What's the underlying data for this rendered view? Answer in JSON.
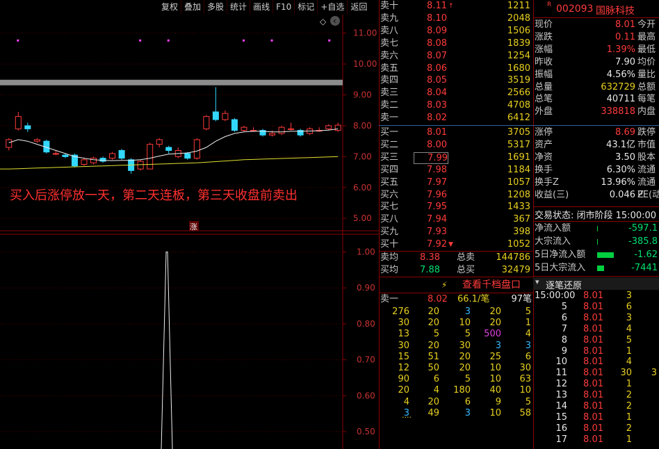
{
  "toolbar": [
    "复权",
    "叠加",
    "多股",
    "统计",
    "画线",
    "F10",
    "标记",
    "+自选",
    "返回"
  ],
  "chart": {
    "price_ticks": [
      "11.00",
      "10.00",
      "9.00",
      "8.00",
      "7.00",
      "6.00",
      "5.00"
    ],
    "indicator_ticks": [
      "1.00",
      "0.90",
      "0.80",
      "0.70",
      "0.60",
      "0.50"
    ],
    "annotation": "买入后涨停放一天，第二天连板，第三天收盘前卖出",
    "limit_badge": "涨",
    "diamond": "◇",
    "scroll_icon": "‹"
  },
  "chart_data": {
    "type": "candlestick",
    "ylim": [
      4.6,
      11.6
    ],
    "candles": [
      {
        "o": 7.3,
        "c": 7.55,
        "h": 7.6,
        "l": 7.2
      },
      {
        "o": 7.9,
        "c": 8.3,
        "h": 8.45,
        "l": 7.85
      },
      {
        "o": 8.0,
        "c": 7.9,
        "h": 8.1,
        "l": 7.8
      },
      {
        "o": 7.5,
        "c": 7.55,
        "h": 7.6,
        "l": 7.45
      },
      {
        "o": 7.5,
        "c": 7.15,
        "h": 7.55,
        "l": 7.1
      },
      {
        "o": 7.1,
        "c": 7.1,
        "h": 7.2,
        "l": 7.05
      },
      {
        "o": 7.05,
        "c": 7.0,
        "h": 7.1,
        "l": 6.95
      },
      {
        "o": 7.05,
        "c": 6.7,
        "h": 7.1,
        "l": 6.65
      },
      {
        "o": 6.75,
        "c": 6.9,
        "h": 6.95,
        "l": 6.7
      },
      {
        "o": 6.8,
        "c": 6.95,
        "h": 7.0,
        "l": 6.75
      },
      {
        "o": 6.95,
        "c": 6.85,
        "h": 7.0,
        "l": 6.8
      },
      {
        "o": 6.95,
        "c": 7.1,
        "h": 7.15,
        "l": 6.9
      },
      {
        "o": 7.2,
        "c": 6.95,
        "h": 7.25,
        "l": 6.9
      },
      {
        "o": 6.9,
        "c": 6.55,
        "h": 6.95,
        "l": 6.45
      },
      {
        "o": 6.6,
        "c": 6.85,
        "h": 6.9,
        "l": 6.55
      },
      {
        "o": 6.6,
        "c": 7.4,
        "h": 7.45,
        "l": 6.6
      },
      {
        "o": 7.4,
        "c": 7.55,
        "h": 7.6,
        "l": 7.3
      },
      {
        "o": 7.3,
        "c": 7.2,
        "h": 7.35,
        "l": 7.1
      },
      {
        "o": 7.0,
        "c": 7.2,
        "h": 7.3,
        "l": 6.95
      },
      {
        "o": 7.1,
        "c": 6.95,
        "h": 7.15,
        "l": 6.9
      },
      {
        "o": 6.95,
        "c": 7.55,
        "h": 7.6,
        "l": 6.9
      },
      {
        "o": 7.9,
        "c": 8.3,
        "h": 8.35,
        "l": 7.85
      },
      {
        "o": 8.45,
        "c": 8.2,
        "h": 9.25,
        "l": 8.15
      },
      {
        "o": 8.2,
        "c": 8.4,
        "h": 8.5,
        "l": 8.15
      },
      {
        "o": 8.2,
        "c": 7.85,
        "h": 8.25,
        "l": 7.8
      },
      {
        "o": 7.85,
        "c": 7.95,
        "h": 8.0,
        "l": 7.8
      },
      {
        "o": 7.85,
        "c": 7.85,
        "h": 7.95,
        "l": 7.8
      },
      {
        "o": 7.85,
        "c": 7.7,
        "h": 7.9,
        "l": 7.65
      },
      {
        "o": 7.7,
        "c": 7.75,
        "h": 7.85,
        "l": 7.65
      },
      {
        "o": 7.75,
        "c": 7.95,
        "h": 8.0,
        "l": 7.7
      },
      {
        "o": 7.9,
        "c": 7.9,
        "h": 8.1,
        "l": 7.85
      },
      {
        "o": 7.85,
        "c": 7.7,
        "h": 7.9,
        "l": 7.65
      },
      {
        "o": 7.75,
        "c": 7.9,
        "h": 7.95,
        "l": 7.7
      },
      {
        "o": 7.85,
        "c": 7.85,
        "h": 7.95,
        "l": 7.8
      },
      {
        "o": 7.9,
        "c": 8.0,
        "h": 8.05,
        "l": 7.85
      },
      {
        "o": 7.85,
        "c": 8.02,
        "h": 8.1,
        "l": 7.8
      }
    ],
    "ma_short": [
      7.45,
      7.55,
      7.5,
      7.4,
      7.3,
      7.2,
      7.1,
      7.0,
      6.95,
      6.9,
      6.88,
      6.87,
      6.88,
      6.88,
      6.9,
      6.95,
      7.02,
      7.08,
      7.1,
      7.12,
      7.18,
      7.3,
      7.5,
      7.65,
      7.75,
      7.8,
      7.82,
      7.82,
      7.8,
      7.8,
      7.82,
      7.82,
      7.83,
      7.84,
      7.86,
      7.9
    ],
    "ma_long": [
      6.6,
      6.61,
      6.62,
      6.63,
      6.64,
      6.65,
      6.66,
      6.67,
      6.68,
      6.69,
      6.7,
      6.71,
      6.72,
      6.73,
      6.74,
      6.75,
      6.76,
      6.77,
      6.78,
      6.79,
      6.8,
      6.82,
      6.84,
      6.86,
      6.88,
      6.9,
      6.91,
      6.92,
      6.93,
      6.94,
      6.95,
      6.96,
      6.97,
      6.98,
      6.99,
      7.0
    ],
    "markers": [
      1,
      14,
      17,
      25,
      28,
      36
    ],
    "indicator": {
      "ylim": [
        0.44,
        1.03
      ],
      "peak_value": 1.0,
      "base": 0.44
    }
  },
  "orderbook": {
    "asks": [
      {
        "label": "卖十",
        "price": "8.11",
        "arrow": "↑",
        "vol": "1211"
      },
      {
        "label": "卖九",
        "price": "8.10",
        "arrow": "",
        "vol": "2048"
      },
      {
        "label": "卖八",
        "price": "8.09",
        "arrow": "",
        "vol": "1506"
      },
      {
        "label": "卖七",
        "price": "8.08",
        "arrow": "",
        "vol": "1839"
      },
      {
        "label": "卖六",
        "price": "8.07",
        "arrow": "",
        "vol": "1254"
      },
      {
        "label": "卖五",
        "price": "8.06",
        "arrow": "",
        "vol": "1680"
      },
      {
        "label": "卖四",
        "price": "8.05",
        "arrow": "",
        "vol": "3519"
      },
      {
        "label": "卖三",
        "price": "8.04",
        "arrow": "",
        "vol": "2566"
      },
      {
        "label": "卖二",
        "price": "8.03",
        "arrow": "",
        "vol": "4708"
      },
      {
        "label": "卖一",
        "price": "8.02",
        "arrow": "",
        "vol": "6412"
      }
    ],
    "bids": [
      {
        "label": "买一",
        "price": "8.01",
        "arrow": "",
        "vol": "3705"
      },
      {
        "label": "买二",
        "price": "8.00",
        "arrow": "",
        "vol": "5317"
      },
      {
        "label": "买三",
        "price": "7.99",
        "arrow": "",
        "vol": "1691"
      },
      {
        "label": "买四",
        "price": "7.98",
        "arrow": "",
        "vol": "1184"
      },
      {
        "label": "买五",
        "price": "7.97",
        "arrow": "",
        "vol": "1057"
      },
      {
        "label": "买六",
        "price": "7.96",
        "arrow": "",
        "vol": "1208"
      },
      {
        "label": "买七",
        "price": "7.95",
        "arrow": "",
        "vol": "1433"
      },
      {
        "label": "买八",
        "price": "7.94",
        "arrow": "",
        "vol": "367"
      },
      {
        "label": "买九",
        "price": "7.93",
        "arrow": "",
        "vol": "398"
      },
      {
        "label": "买十",
        "price": "7.92",
        "arrow": "▼",
        "vol": "1052"
      }
    ],
    "avg_ask": {
      "label": "卖均",
      "price": "8.38",
      "tlabel": "总卖",
      "vol": "144786"
    },
    "avg_bid": {
      "label": "买均",
      "price": "7.88",
      "tlabel": "总买",
      "vol": "32479"
    },
    "depth_button": "查看千档盘口",
    "lightning_icon": "⚡",
    "depth_head": {
      "label": "卖一",
      "price": "8.02",
      "per": "66.1/笔",
      "count": "97笔"
    },
    "depth_rows": [
      [
        "276",
        "20",
        "3",
        "20",
        "5"
      ],
      [
        "30",
        "20",
        "10",
        "20",
        "1"
      ],
      [
        "13",
        "5",
        "5",
        "500",
        "4"
      ],
      [
        "30",
        "20",
        "30",
        "3",
        "3"
      ],
      [
        "15",
        "51",
        "20",
        "25",
        "6"
      ],
      [
        "12",
        "50",
        "20",
        "10",
        "30"
      ],
      [
        "90",
        "6",
        "5",
        "10",
        "63"
      ],
      [
        "20",
        "4",
        "180",
        "40",
        "10"
      ],
      [
        "4",
        "20",
        "6",
        "9",
        "5"
      ],
      [
        "3",
        "49",
        "3",
        "10",
        "58"
      ]
    ],
    "ellipsis": "....",
    "highlight_color": "#e040e0",
    "blue_color": "#33b8ff"
  },
  "quote": {
    "code": "002093",
    "name": "国脉科技",
    "tag": "R",
    "rows": [
      {
        "l": "现价",
        "v": "8.01",
        "vc": "red",
        "r": "今开"
      },
      {
        "l": "涨跌",
        "v": "0.11",
        "vc": "red",
        "r": "最高"
      },
      {
        "l": "涨幅",
        "v": "1.39%",
        "vc": "red",
        "r": "最低"
      },
      {
        "l": "昨收",
        "v": "7.90",
        "vc": "white",
        "r": "均价"
      },
      {
        "l": "振幅",
        "v": "4.56%",
        "vc": "white",
        "r": "量比"
      },
      {
        "l": "总量",
        "v": "632729",
        "vc": "yellow",
        "r": "总额"
      },
      {
        "l": "总笔",
        "v": "40711",
        "vc": "white",
        "r": "每笔"
      },
      {
        "l": "外盘",
        "v": "338818",
        "vc": "red",
        "r": "内盘"
      },
      {
        "l": "涨停",
        "v": "8.69",
        "vc": "red",
        "r": "跌停"
      },
      {
        "l": "资产",
        "v": "43.1亿",
        "vc": "white",
        "r": "市值"
      },
      {
        "l": "净资",
        "v": "3.50",
        "vc": "white",
        "r": "股本"
      },
      {
        "l": "换手",
        "v": "6.30%",
        "vc": "white",
        "r": "流通"
      },
      {
        "l": "换手Z",
        "v": "13.96%",
        "vc": "white",
        "r": "流通Z"
      },
      {
        "l": "收益(三)",
        "v": "0.046",
        "vc": "white",
        "r": "PE(动)"
      }
    ],
    "status": "交易状态: 闭市阶段 15:00:00",
    "flows": [
      {
        "l": "净流入额",
        "v": "-597.1",
        "bar": 0
      },
      {
        "l": "大宗流入",
        "v": "-385.8",
        "bar": 0
      },
      {
        "l": "5日净流入额",
        "v": "-1.62",
        "bar": 24
      },
      {
        "l": "5日大宗流入",
        "v": "-7441",
        "bar": 10
      }
    ],
    "ticks_title": "逐笔还原",
    "ticks_icon": "▾",
    "ticks": [
      [
        "15:00:00",
        "8.01",
        "3"
      ],
      [
        "5",
        "8.01",
        "6"
      ],
      [
        "6",
        "8.01",
        "3"
      ],
      [
        "7",
        "8.01",
        "4"
      ],
      [
        "8",
        "8.01",
        "5"
      ],
      [
        "9",
        "8.01",
        "1"
      ],
      [
        "10",
        "8.01",
        "4"
      ],
      [
        "11",
        "8.01",
        "30",
        "3"
      ],
      [
        "12",
        "8.01",
        "1"
      ],
      [
        "13",
        "8.01",
        "2"
      ],
      [
        "14",
        "8.01",
        "2"
      ],
      [
        "15",
        "8.01",
        "1"
      ],
      [
        "16",
        "8.01",
        "2"
      ],
      [
        "17",
        "8.01",
        "1"
      ]
    ]
  }
}
